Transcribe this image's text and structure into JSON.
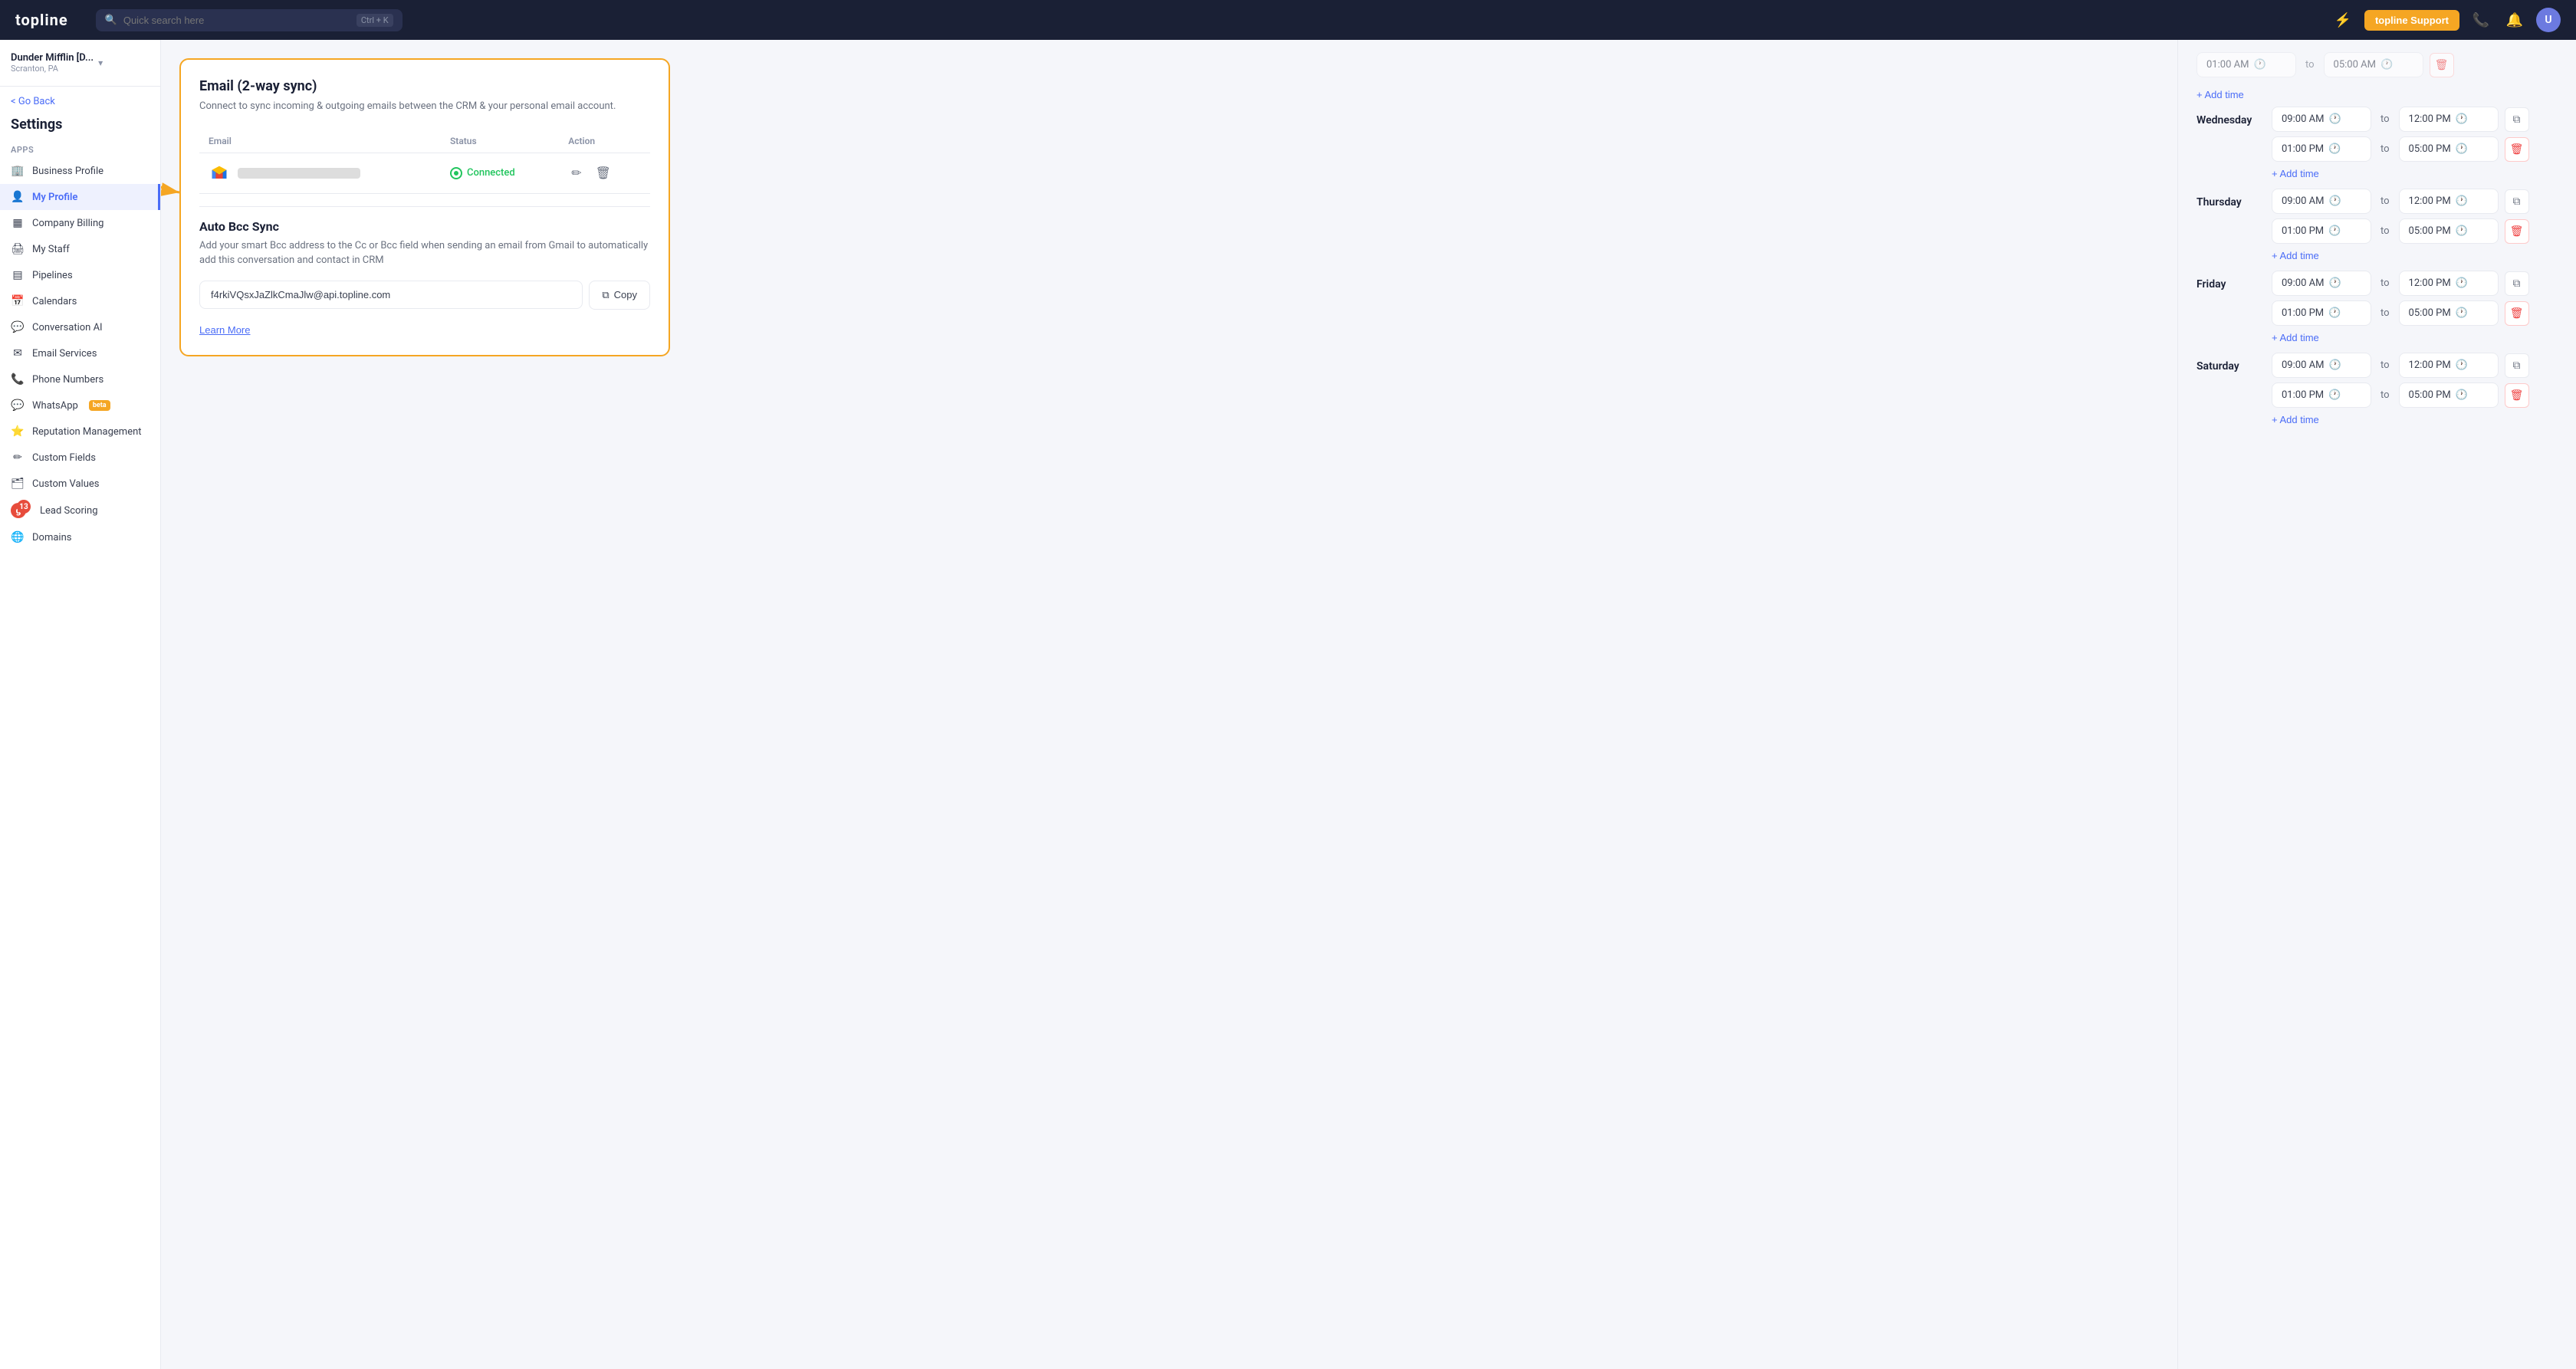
{
  "topnav": {
    "logo": "topline",
    "search_placeholder": "Quick search here",
    "search_shortcut": "Ctrl + K",
    "support_btn": "topline Support",
    "lightning_icon": "⚡"
  },
  "workspace": {
    "name": "Dunder Mifflin [D...",
    "location": "Scranton, PA"
  },
  "sidebar": {
    "go_back": "< Go Back",
    "settings_title": "Settings",
    "apps_label": "Apps",
    "items": [
      {
        "id": "business-profile",
        "label": "Business Profile",
        "icon": "🏢",
        "active": false
      },
      {
        "id": "my-profile",
        "label": "My Profile",
        "icon": "👤",
        "active": true
      },
      {
        "id": "company-billing",
        "label": "Company Billing",
        "icon": "▦",
        "active": false
      },
      {
        "id": "my-staff",
        "label": "My Staff",
        "icon": "🖨",
        "active": false
      },
      {
        "id": "pipelines",
        "label": "Pipelines",
        "icon": "▤",
        "active": false
      },
      {
        "id": "calendars",
        "label": "Calendars",
        "icon": "📅",
        "active": false
      },
      {
        "id": "conversation-ai",
        "label": "Conversation AI",
        "icon": "💬",
        "active": false
      },
      {
        "id": "email-services",
        "label": "Email Services",
        "icon": "✉",
        "active": false
      },
      {
        "id": "phone-numbers",
        "label": "Phone Numbers",
        "icon": "📞",
        "active": false
      },
      {
        "id": "whatsapp",
        "label": "WhatsApp",
        "icon": "💬",
        "active": false,
        "badge": "beta"
      },
      {
        "id": "reputation-management",
        "label": "Reputation Management",
        "icon": "⭐",
        "active": false
      },
      {
        "id": "custom-fields",
        "label": "Custom Fields",
        "icon": "✏",
        "active": false
      },
      {
        "id": "custom-values",
        "label": "Custom Values",
        "icon": "🗂",
        "active": false
      },
      {
        "id": "lead-scoring",
        "label": "Lead Scoring",
        "icon": "g",
        "active": false,
        "notif": "13"
      },
      {
        "id": "domains",
        "label": "Domains",
        "icon": "🌐",
        "active": false
      }
    ]
  },
  "email_section": {
    "title": "Email (2-way sync)",
    "description": "Connect to sync incoming & outgoing emails between the CRM & your personal email account.",
    "table": {
      "columns": [
        "Email",
        "Status",
        "Action"
      ],
      "rows": [
        {
          "email_blurred": true,
          "status": "Connected",
          "actions": [
            "edit",
            "delete"
          ]
        }
      ]
    }
  },
  "auto_bcc": {
    "title": "Auto Bcc Sync",
    "description": "Add your smart Bcc address to the Cc or Bcc field when sending an email from Gmail to automatically add this conversation and contact in CRM",
    "email_value": "f4rkiVQsxJaZlkCmaJlw@api.topline.com",
    "copy_btn": "Copy",
    "learn_more": "Learn More"
  },
  "schedule": {
    "partial_top": {
      "time1_start": "01:00 AM",
      "time1_end": "05:00 AM"
    },
    "days": [
      {
        "label": "Wednesday",
        "slots": [
          {
            "start": "09:00 AM",
            "end": "12:00 PM"
          },
          {
            "start": "01:00 PM",
            "end": "05:00 PM"
          }
        ],
        "add_time": "+ Add time"
      },
      {
        "label": "Thursday",
        "slots": [
          {
            "start": "09:00 AM",
            "end": "12:00 PM"
          },
          {
            "start": "01:00 PM",
            "end": "05:00 PM"
          }
        ],
        "add_time": "+ Add time"
      },
      {
        "label": "Friday",
        "slots": [
          {
            "start": "09:00 AM",
            "end": "12:00 PM"
          },
          {
            "start": "01:00 PM",
            "end": "05:00 PM"
          }
        ],
        "add_time": "+ Add time"
      },
      {
        "label": "Saturday",
        "slots": [
          {
            "start": "09:00 AM",
            "end": "12:00 PM"
          },
          {
            "start": "01:00 PM",
            "end": "05:00 PM"
          }
        ],
        "add_time": "+ Add time"
      }
    ],
    "to_label": "to"
  }
}
